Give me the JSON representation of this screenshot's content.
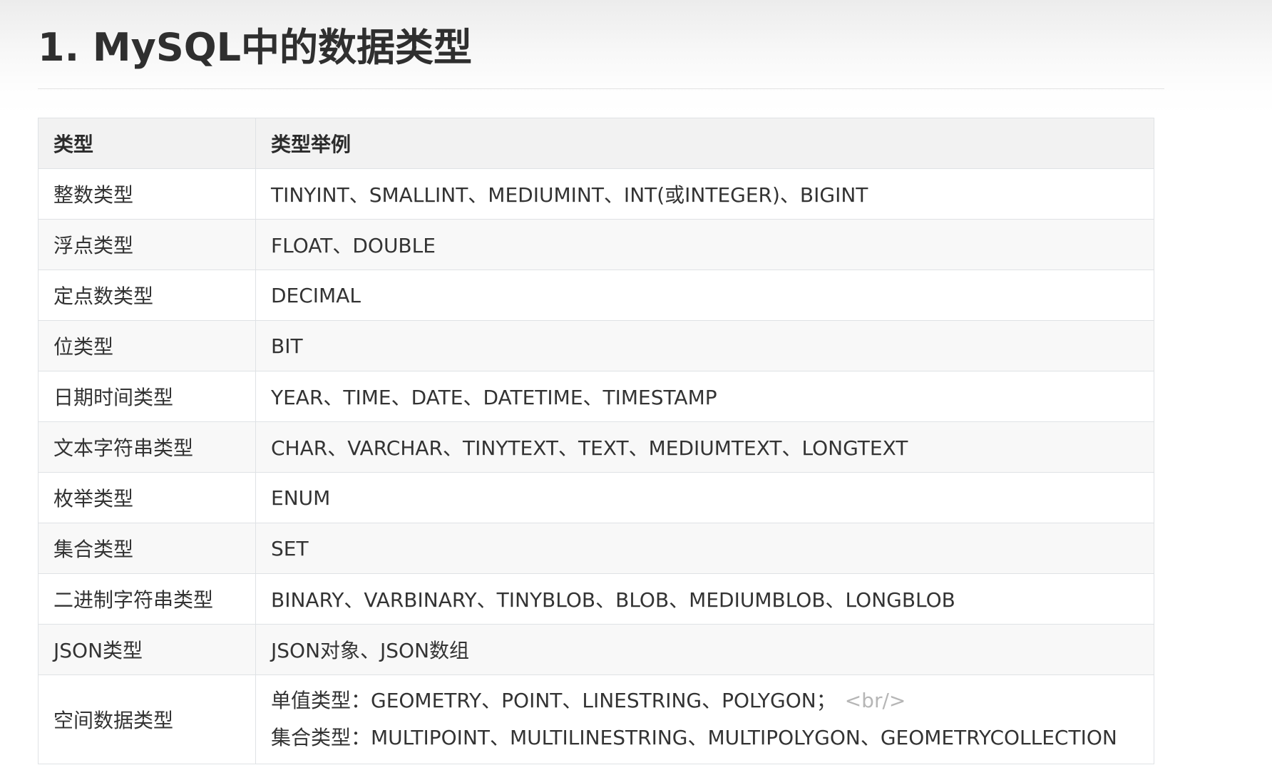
{
  "heading": "1. MySQL中的数据类型",
  "table": {
    "headers": [
      "类型",
      "类型举例"
    ],
    "rows": [
      {
        "type": "整数类型",
        "examples": "TINYINT、SMALLINT、MEDIUMINT、INT(或INTEGER)、BIGINT"
      },
      {
        "type": "浮点类型",
        "examples": "FLOAT、DOUBLE"
      },
      {
        "type": "定点数类型",
        "examples": "DECIMAL"
      },
      {
        "type": "位类型",
        "examples": "BIT"
      },
      {
        "type": "日期时间类型",
        "examples": "YEAR、TIME、DATE、DATETIME、TIMESTAMP"
      },
      {
        "type": "文本字符串类型",
        "examples": "CHAR、VARCHAR、TINYTEXT、TEXT、MEDIUMTEXT、LONGTEXT"
      },
      {
        "type": "枚举类型",
        "examples": "ENUM"
      },
      {
        "type": "集合类型",
        "examples": "SET"
      },
      {
        "type": "二进制字符串类型",
        "examples": "BINARY、VARBINARY、TINYBLOB、BLOB、MEDIUMBLOB、LONGBLOB"
      },
      {
        "type": "JSON类型",
        "examples": "JSON对象、JSON数组"
      }
    ],
    "spatial_row": {
      "type": "空间数据类型",
      "line1": "单值类型：GEOMETRY、POINT、LINESTRING、POLYGON；",
      "line1_tag": "<br/>",
      "line2": "集合类型：MULTIPOINT、MULTILINESTRING、MULTIPOLYGON、GEOMETRYCOLLECTION"
    }
  }
}
